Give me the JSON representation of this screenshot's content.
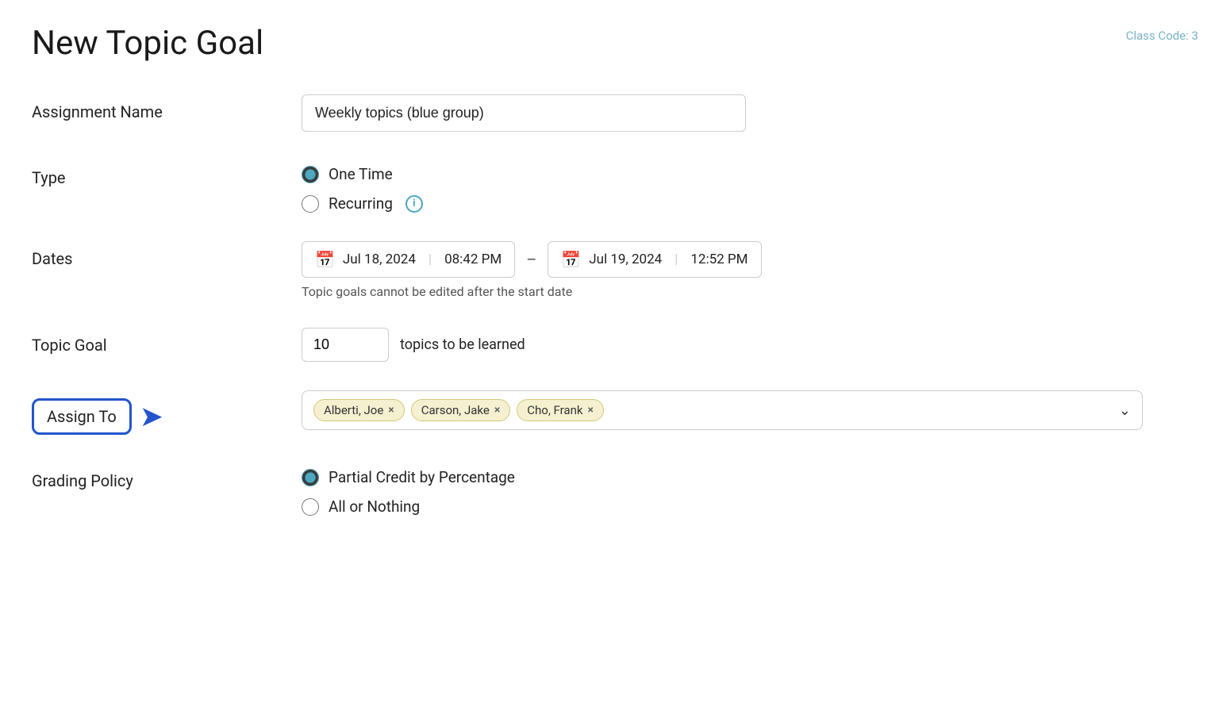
{
  "header": {
    "title": "New Topic Goal",
    "class_code": "Class Code: 3"
  },
  "form": {
    "assignment_name_label": "Assignment Name",
    "assignment_name_value": "Weekly topics (blue group)",
    "assignment_name_placeholder": "",
    "type_label": "Type",
    "type_options": [
      {
        "value": "one_time",
        "label": "One Time",
        "checked": true
      },
      {
        "value": "recurring",
        "label": "Recurring",
        "checked": false,
        "has_info": true
      }
    ],
    "dates_label": "Dates",
    "start_date": "Jul 18, 2024",
    "start_time": "08:42 PM",
    "end_date": "Jul 19, 2024",
    "end_time": "12:52 PM",
    "dates_note": "Topic goals cannot be edited after the start date",
    "topic_goal_label": "Topic Goal",
    "topic_goal_value": "10",
    "topic_goal_suffix": "topics to be learned",
    "assign_to_label": "Assign To",
    "assignees": [
      {
        "name": "Alberti, Joe"
      },
      {
        "name": "Carson, Jake"
      },
      {
        "name": "Cho, Frank"
      }
    ],
    "grading_policy_label": "Grading Policy",
    "grading_options": [
      {
        "value": "partial_credit",
        "label": "Partial Credit by Percentage",
        "checked": true
      },
      {
        "value": "all_or_nothing",
        "label": "All or Nothing",
        "checked": false
      }
    ]
  },
  "icons": {
    "calendar": "📅",
    "info": "i",
    "chevron_down": "⌄",
    "arrow_right": "➤",
    "remove": "×"
  }
}
